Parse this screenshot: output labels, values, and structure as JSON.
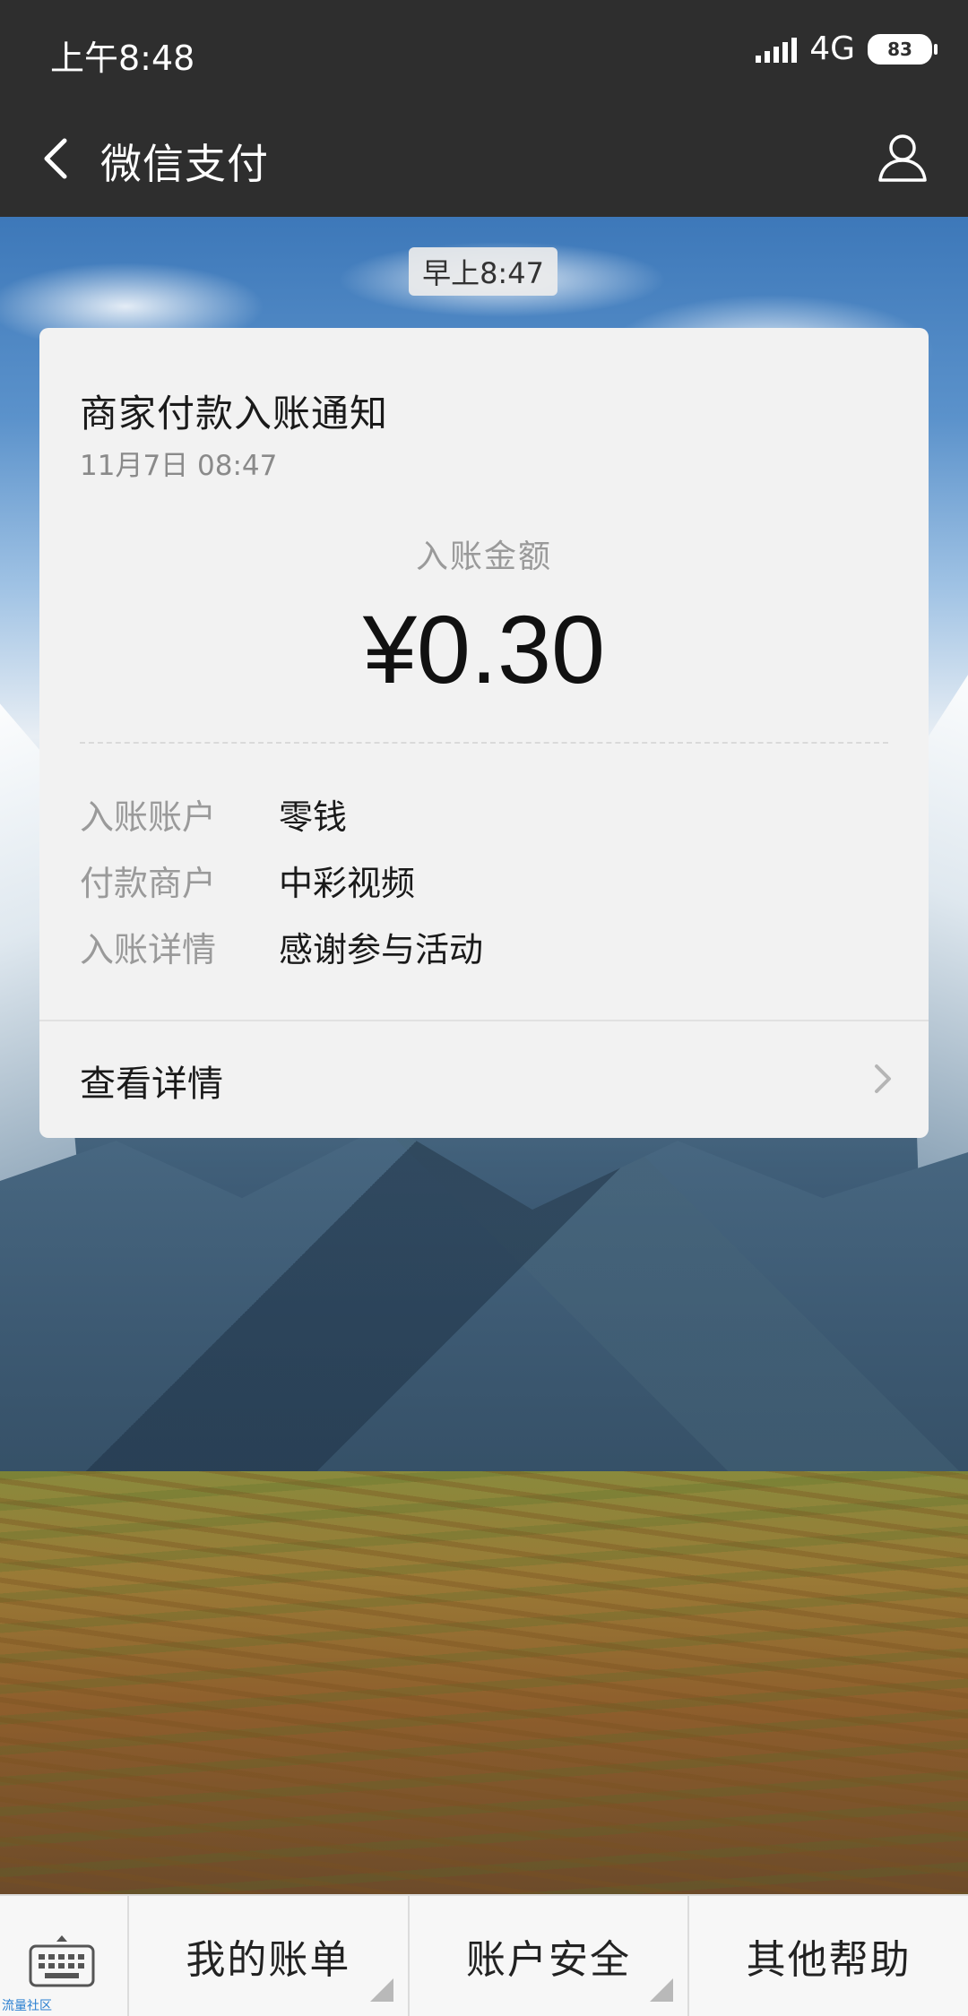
{
  "status_bar": {
    "time": "上午8:48",
    "network": "4G",
    "battery": "83"
  },
  "nav": {
    "title": "微信支付"
  },
  "message": {
    "time_chip": "早上8:47",
    "card": {
      "title": "商家付款入账通知",
      "date": "11月7日  08:47",
      "amount_label": "入账金额",
      "amount": "¥0.30",
      "rows": [
        {
          "key": "入账账户",
          "value": "零钱"
        },
        {
          "key": "付款商户",
          "value": "中彩视频"
        },
        {
          "key": "入账详情",
          "value": "感谢参与活动"
        }
      ],
      "detail_link": "查看详情"
    }
  },
  "bottom_menu": {
    "items": [
      {
        "label": "我的账单"
      },
      {
        "label": "账户安全"
      },
      {
        "label": "其他帮助"
      }
    ],
    "watermark": "流量社区"
  },
  "colors": {
    "topbar": "#2e2e2e",
    "card_bg": "#f2f2f2",
    "bottom_bar": "#f7f7f7"
  }
}
